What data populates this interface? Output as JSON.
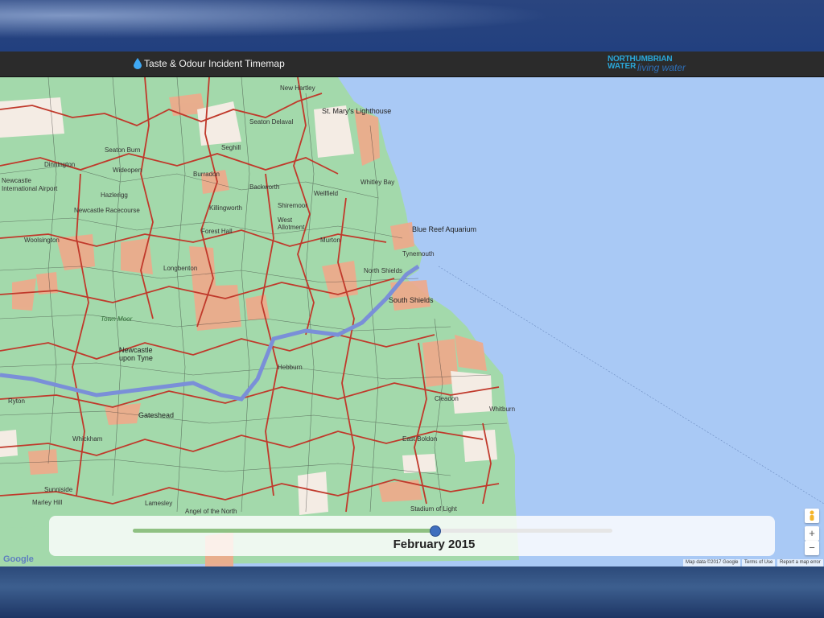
{
  "header": {
    "title": "Taste & Odour Incident Timemap"
  },
  "logo": {
    "line1": "NORTHUMBRIAN",
    "line2": "WATER",
    "line3": "living water"
  },
  "map": {
    "labels": [
      {
        "text": "St. Mary's Lighthouse"
      },
      {
        "text": "Blue Reef Aquarium"
      },
      {
        "text": "Newcastle International Airport"
      },
      {
        "text": "Newcastle Racecourse"
      },
      {
        "text": "New Hartley"
      },
      {
        "text": "Seaton Delaval"
      },
      {
        "text": "Seghill"
      },
      {
        "text": "Seaton Burn"
      },
      {
        "text": "Wideopen"
      },
      {
        "text": "Hazlerigg"
      },
      {
        "text": "Dinnington"
      },
      {
        "text": "Whitley Bay"
      },
      {
        "text": "Burradon"
      },
      {
        "text": "Killingworth"
      },
      {
        "text": "Backworth"
      },
      {
        "text": "Shiremoor"
      },
      {
        "text": "West Allotment"
      },
      {
        "text": "Wellfield"
      },
      {
        "text": "Forest Hall"
      },
      {
        "text": "Murton"
      },
      {
        "text": "Tynemouth"
      },
      {
        "text": "North Shields"
      },
      {
        "text": "South Shields"
      },
      {
        "text": "Woolsington"
      },
      {
        "text": "Longbenton"
      },
      {
        "text": "Town Moor"
      },
      {
        "text": "Newcastle upon Tyne"
      },
      {
        "text": "Gateshead"
      },
      {
        "text": "Hebburn"
      },
      {
        "text": "East Boldon"
      },
      {
        "text": "Stadium of Light"
      },
      {
        "text": "Angel of the North"
      },
      {
        "text": "Whickham"
      },
      {
        "text": "Sunniside"
      },
      {
        "text": "Marley Hill"
      },
      {
        "text": "Lamesley"
      },
      {
        "text": "Cleadon"
      },
      {
        "text": "Whitburn"
      },
      {
        "text": "Ryton"
      }
    ]
  },
  "timeline": {
    "date_label": "February 2015",
    "progress": 0.63
  },
  "controls": {
    "zoom_in": "+",
    "zoom_out": "−"
  },
  "attribution": {
    "google": "Google",
    "map_data": "Map data ©2017 Google",
    "terms": "Terms of Use",
    "report": "Report a map error"
  },
  "colors": {
    "area_ok": "#9fd6a8",
    "area_incident": "#f0a98a",
    "area_none": "#f4ece4",
    "boundary": "#c0392b",
    "river": "#7a8fd8",
    "sea": "#a9c9f5"
  }
}
